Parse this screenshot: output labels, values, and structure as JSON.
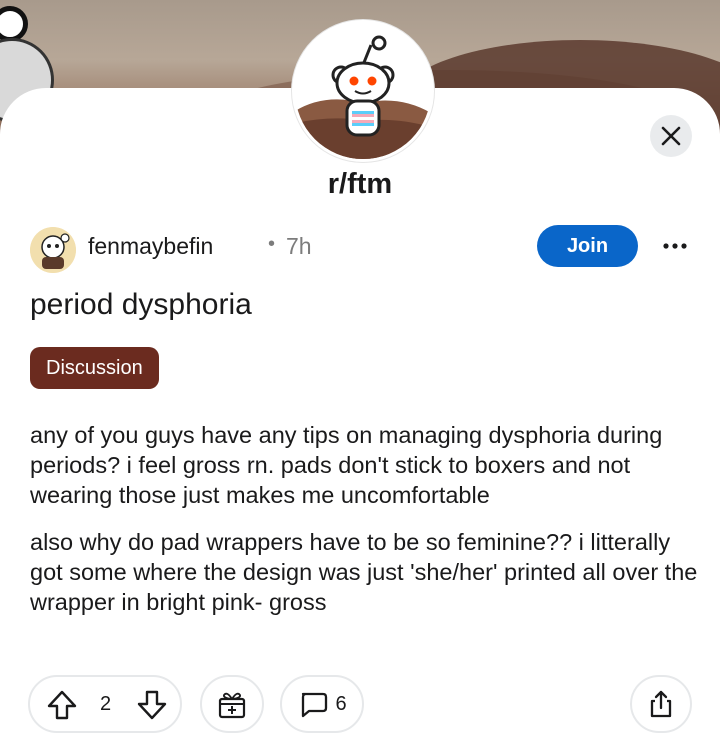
{
  "subreddit": {
    "name": "r/ftm"
  },
  "post": {
    "author": "fenmaybefin",
    "separator": "•",
    "age": "7h",
    "join_label": "Join",
    "title": "period dysphoria",
    "flair": "Discussion",
    "body": [
      "any of you guys have any tips on managing dysphoria during periods? i feel gross rn. pads don't stick to boxers and not wearing those just makes me uncomfortable",
      "also why do pad wrappers have to be so feminine?? i litterally got some where the design was just 'she/her' printed all over the wrapper in bright pink- gross"
    ]
  },
  "actions": {
    "vote_count": "2",
    "comment_count": "6"
  },
  "icons": {
    "close": "close-icon",
    "more": "more-options-icon",
    "upvote": "upvote-icon",
    "downvote": "downvote-icon",
    "award": "award-icon",
    "comment": "comment-icon",
    "share": "share-icon"
  },
  "colors": {
    "join_button": "#0a66c9",
    "flair_background": "#6b2b1f"
  }
}
